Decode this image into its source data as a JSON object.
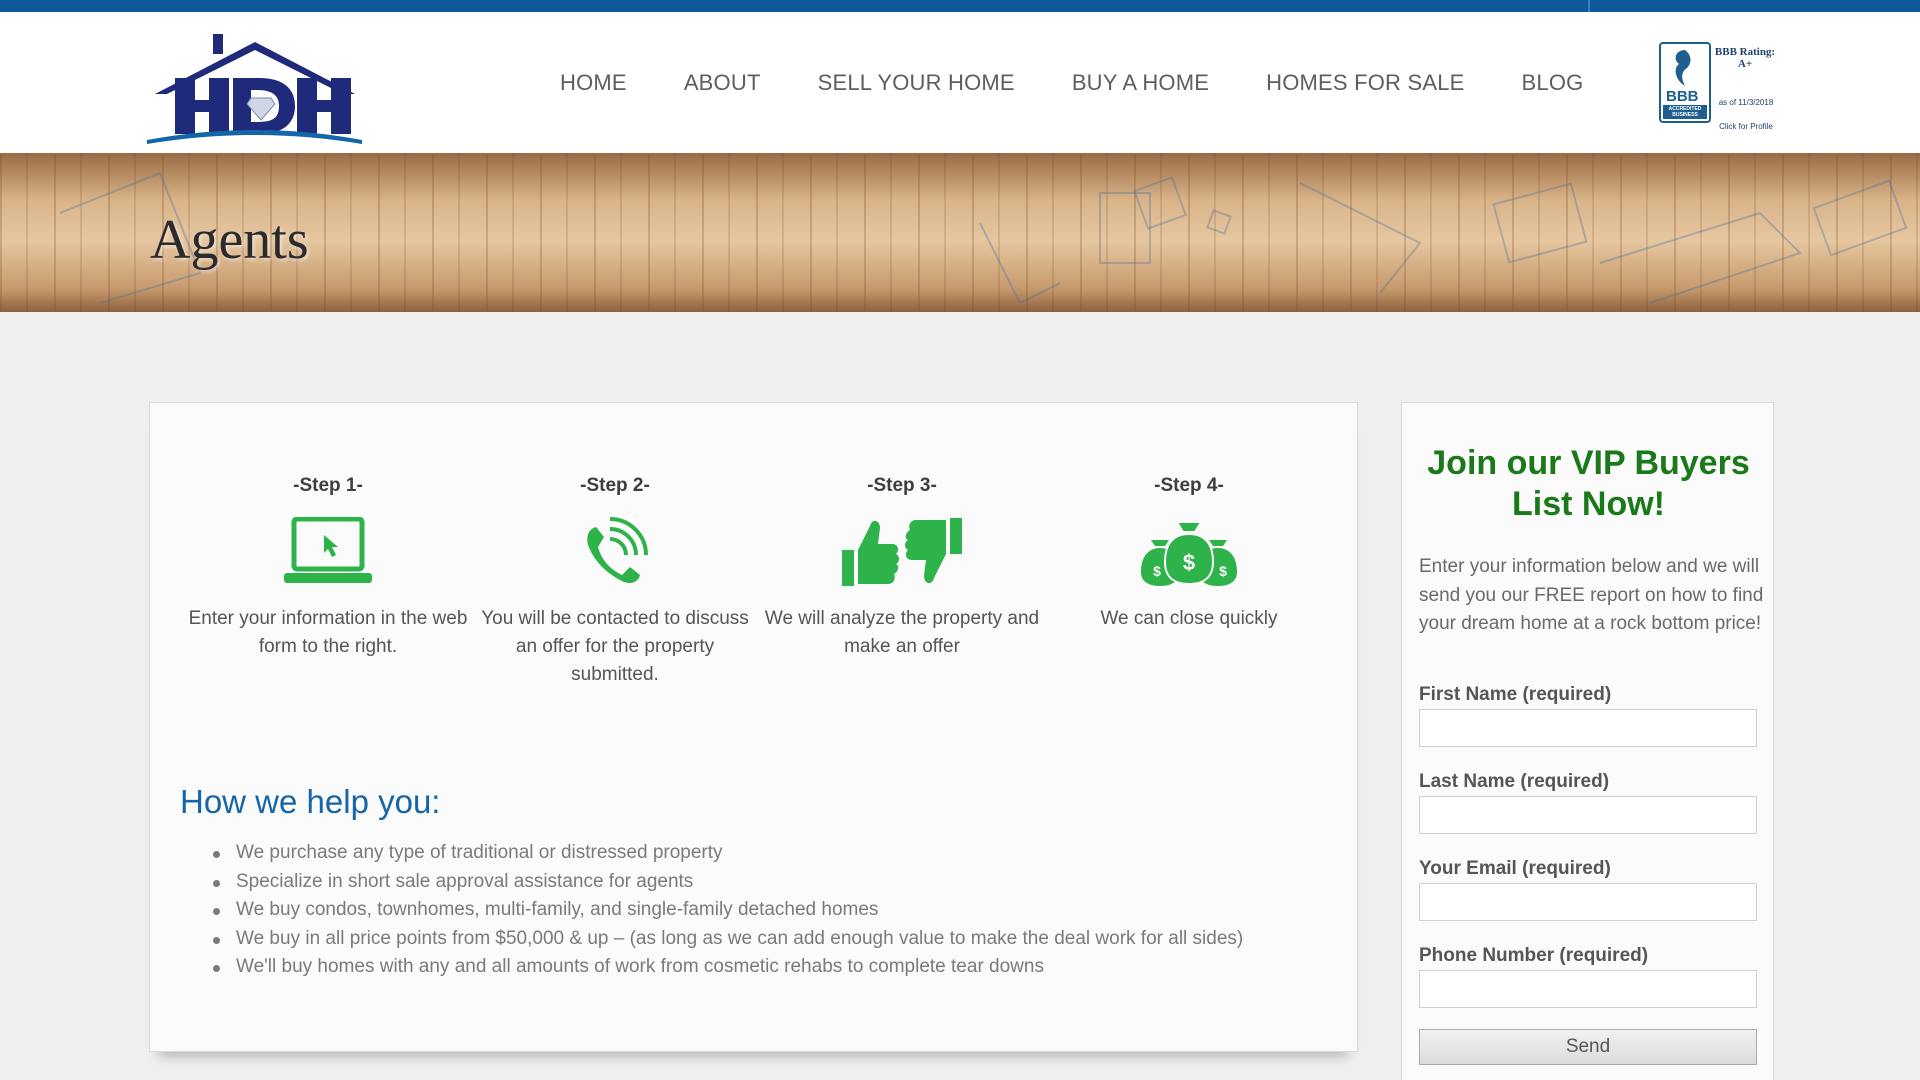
{
  "brand": {
    "logo_text": "HDH"
  },
  "nav": {
    "items": [
      "HOME",
      "ABOUT",
      "SELL YOUR HOME",
      "BUY A HOME",
      "HOMES FOR SALE",
      "BLOG"
    ]
  },
  "bbb": {
    "seal_text": "BBB",
    "accredited": "ACCREDITED BUSINESS",
    "rating_label": "BBB Rating: A+",
    "as_of": "as of 11/3/2018",
    "click": "Click for Profile"
  },
  "banner": {
    "title": "Agents"
  },
  "steps": [
    {
      "title": "-Step 1-",
      "desc": "Enter your information in the web form to the right.",
      "icon": "laptop-cursor-icon"
    },
    {
      "title": "-Step 2-",
      "desc": "You will be contacted to discuss an offer for the property submitted.",
      "icon": "phone-call-icon"
    },
    {
      "title": "-Step 3-",
      "desc": "We will analyze the property and make an offer",
      "icon": "thumbs-up-down-icon"
    },
    {
      "title": "-Step 4-",
      "desc": "We can close quickly",
      "icon": "money-bags-icon"
    }
  ],
  "help": {
    "title": "How we help you:",
    "items": [
      "We purchase any type of traditional or distressed property",
      "Specialize in short sale approval assistance for agents",
      "We buy condos, townhomes, multi-family, and single-family detached homes",
      "We buy in all price points from $50,000 & up – (as long as we can add enough value to make the deal work for all sides)",
      "We'll buy homes with any and all amounts of work from cosmetic rehabs to complete tear downs"
    ]
  },
  "signup": {
    "title": "Join our VIP Buyers List Now!",
    "intro": "Enter your information below and we will send you our FREE report on how to find your dream home at a rock bottom price!",
    "fields": [
      {
        "label": "First Name (required)",
        "value": ""
      },
      {
        "label": "Last Name (required)",
        "value": ""
      },
      {
        "label": "Your Email (required)",
        "value": ""
      },
      {
        "label": "Phone Number (required)",
        "value": ""
      }
    ],
    "send_label": "Send"
  },
  "colors": {
    "topbar": "#0d5a9a",
    "icon_green": "#2db34a",
    "signup_title": "#1a7a1a",
    "help_title": "#1466a8",
    "logo_navy": "#1f2a7a"
  }
}
